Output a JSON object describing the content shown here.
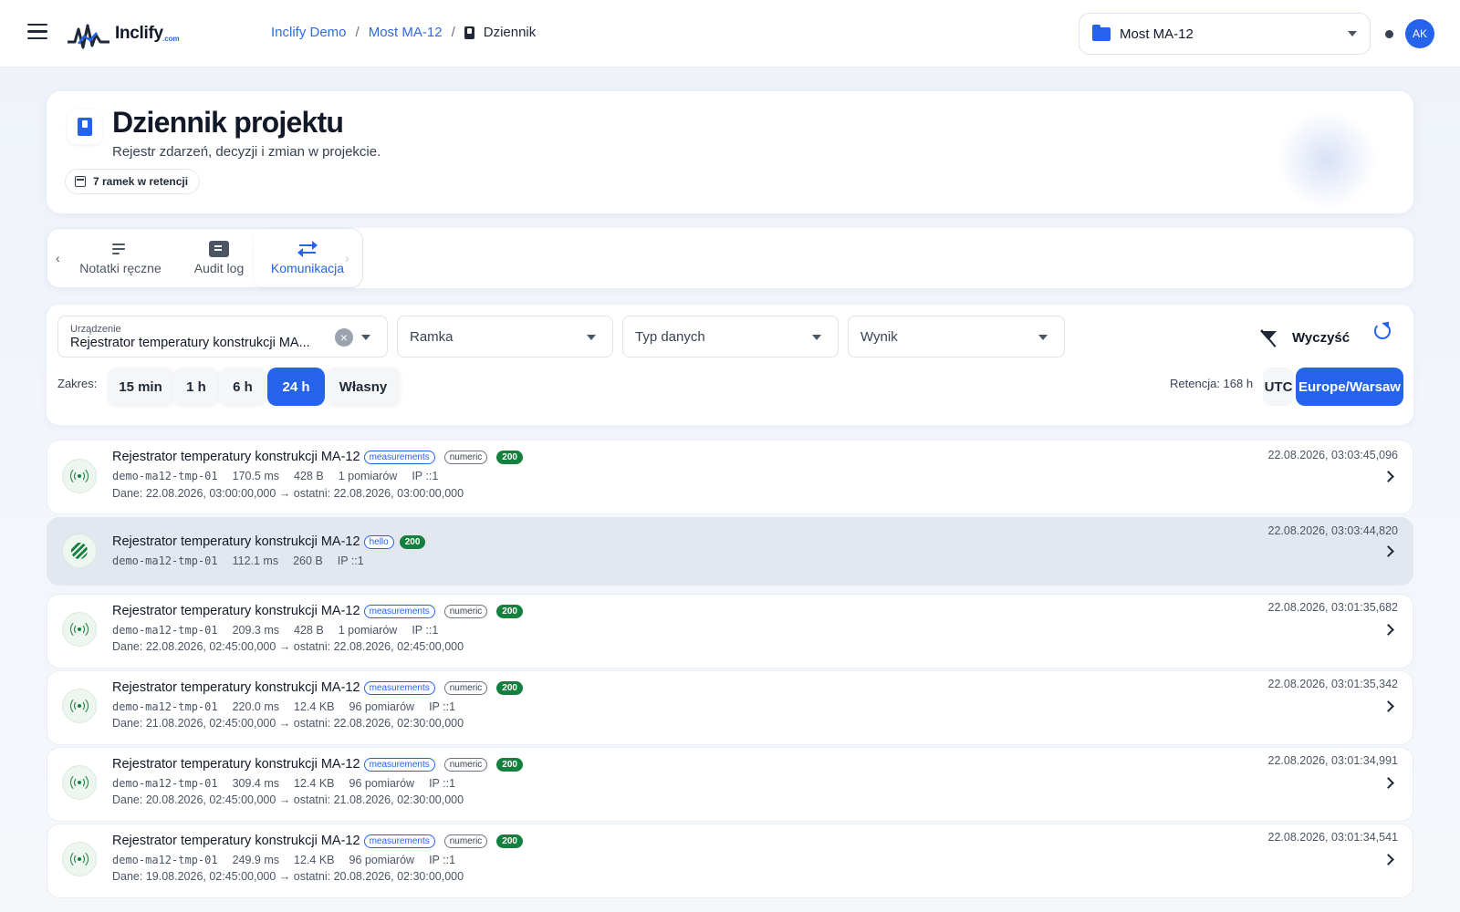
{
  "app": {
    "brand": "Inclify",
    "brand_suffix": ".com",
    "breadcrumb": [
      "Inclify Demo",
      "Most MA-12",
      "Dziennik"
    ],
    "project_select": "Most MA-12",
    "avatar": "AK"
  },
  "header": {
    "title": "Dziennik projektu",
    "subtitle": "Rejestr zdarzeń, decyzji i zmian w projekcie.",
    "retention_chip": "7 ramek w retencji"
  },
  "tabs": [
    {
      "label": "Notatki ręczne",
      "icon": "notes-edit-icon"
    },
    {
      "label": "Audit log",
      "icon": "checklist-icon"
    },
    {
      "label": "Komunikacja",
      "icon": "swap-arrows-icon",
      "active": true
    }
  ],
  "filters": {
    "device_label": "Urządzenie",
    "device_value": "Rejestrator temperatury konstrukcji MA...",
    "frame_placeholder": "Ramka",
    "type_placeholder": "Typ danych",
    "result_placeholder": "Wynik",
    "clear_label": "Wyczyść",
    "range_label": "Zakres:",
    "ranges": [
      "15 min",
      "1 h",
      "6 h",
      "24 h",
      "Własny"
    ],
    "active_range": "24 h",
    "retention": "Retencja: 168 h",
    "tz_utc": "UTC",
    "tz_local": "Europe/Warsaw"
  },
  "colors": {
    "accent": "#2563eb",
    "success": "#15803d"
  },
  "log": [
    {
      "title": "Rejestrator temperatury konstrukcji MA-12",
      "tags": [
        "measurements",
        "numeric"
      ],
      "status": "200",
      "device": "demo-ma12-tmp-01",
      "ms": "170.5 ms",
      "size": "428 B",
      "count": "1 pomiarów",
      "ip": "IP ::1",
      "data_from": "Dane: 22.08.2026, 03:00:00,000",
      "data_to": "ostatni: 22.08.2026, 03:00:00,000",
      "time": "22.08.2026, 03:03:45,096",
      "icon": "radio-signal-icon"
    },
    {
      "title": "Rejestrator temperatury konstrukcji MA-12",
      "tags": [
        "hello"
      ],
      "status": "200",
      "device": "demo-ma12-tmp-01",
      "ms": "112.1 ms",
      "size": "260 B",
      "count": "",
      "ip": "IP ::1",
      "data_from": "",
      "data_to": "",
      "time": "22.08.2026, 03:03:44,820",
      "icon": "handshake-icon"
    },
    {
      "title": "Rejestrator temperatury konstrukcji MA-12",
      "tags": [
        "measurements",
        "numeric"
      ],
      "status": "200",
      "device": "demo-ma12-tmp-01",
      "ms": "209.3 ms",
      "size": "428 B",
      "count": "1 pomiarów",
      "ip": "IP ::1",
      "data_from": "Dane: 22.08.2026, 02:45:00,000",
      "data_to": "ostatni: 22.08.2026, 02:45:00,000",
      "time": "22.08.2026, 03:01:35,682",
      "icon": "radio-signal-icon"
    },
    {
      "title": "Rejestrator temperatury konstrukcji MA-12",
      "tags": [
        "measurements",
        "numeric"
      ],
      "status": "200",
      "device": "demo-ma12-tmp-01",
      "ms": "220.0 ms",
      "size": "12.4 KB",
      "count": "96 pomiarów",
      "ip": "IP ::1",
      "data_from": "Dane: 21.08.2026, 02:45:00,000",
      "data_to": "ostatni: 22.08.2026, 02:30:00,000",
      "time": "22.08.2026, 03:01:35,342",
      "icon": "radio-signal-icon"
    },
    {
      "title": "Rejestrator temperatury konstrukcji MA-12",
      "tags": [
        "measurements",
        "numeric"
      ],
      "status": "200",
      "device": "demo-ma12-tmp-01",
      "ms": "309.4 ms",
      "size": "12.4 KB",
      "count": "96 pomiarów",
      "ip": "IP ::1",
      "data_from": "Dane: 20.08.2026, 02:45:00,000",
      "data_to": "ostatni: 21.08.2026, 02:30:00,000",
      "time": "22.08.2026, 03:01:34,991",
      "icon": "radio-signal-icon"
    },
    {
      "title": "Rejestrator temperatury konstrukcji MA-12",
      "tags": [
        "measurements",
        "numeric"
      ],
      "status": "200",
      "device": "demo-ma12-tmp-01",
      "ms": "249.9 ms",
      "size": "12.4 KB",
      "count": "96 pomiarów",
      "ip": "IP ::1",
      "data_from": "Dane: 19.08.2026, 02:45:00,000",
      "data_to": "ostatni: 20.08.2026, 02:30:00,000",
      "time": "22.08.2026, 03:01:34,541",
      "icon": "radio-signal-icon"
    }
  ]
}
